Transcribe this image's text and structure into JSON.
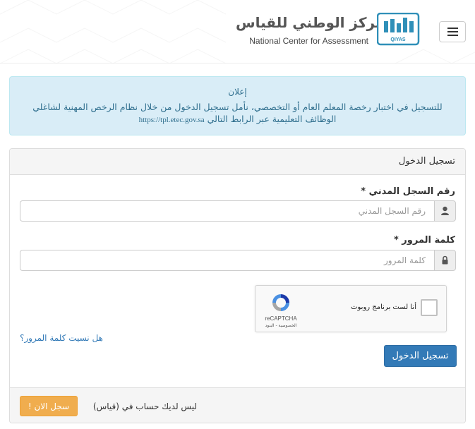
{
  "header": {
    "logo_ar": "المركز الوطني للقياس",
    "logo_en": "National Center for Assessment",
    "logo_mark_text": "QIYAS",
    "menu_icon": "hamburger-icon"
  },
  "announcement": {
    "title": "إعلان",
    "line1": "للتسجيل في اختبار رخصة المعلم العام أو التخصصي، نأمل تسجيل الدخول من خلال نظام الرخص المهنية لشاغلي",
    "line2": "الوظائف التعليمية عبر الرابط التالي",
    "link": "https://tpl.etec.gov.sa"
  },
  "login": {
    "panel_title": "تسجيل الدخول",
    "id_label": "رقم السجل المدني *",
    "id_placeholder": "رقم السجل المدني",
    "id_icon": "user-icon",
    "password_label": "كلمة المرور *",
    "password_placeholder": "كلمة المرور",
    "password_icon": "lock-icon",
    "recaptcha_text": "أنا لست برنامج روبوت",
    "recaptcha_brand": "reCAPTCHA",
    "recaptcha_terms": "الخصوصية - البنود",
    "forgot_link": "هل نسيت كلمة المرور؟",
    "submit_label": "تسجيل الدخول"
  },
  "footer": {
    "no_account_text": "ليس لديك حساب في (قياس)",
    "signup_label": "سجل الان !"
  },
  "colors": {
    "primary": "#337ab7",
    "warning": "#f0ad4e",
    "info_bg": "#d9edf7",
    "info_text": "#31708f",
    "brand_teal": "#2f8fb8"
  }
}
